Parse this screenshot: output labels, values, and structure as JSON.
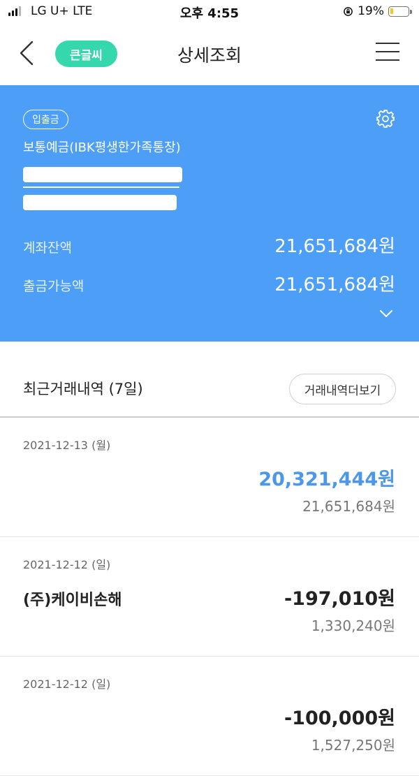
{
  "status_bar": {
    "carrier": "LG U+  LTE",
    "time": "오후 4:55",
    "battery": "19%",
    "battery_level": 0.19
  },
  "header": {
    "back_icon": "chevron-left-icon",
    "pill_label": "큰글씨",
    "title": "상세조회",
    "menu_icon": "hamburger-menu-icon",
    "accent_color": "#35d7ad"
  },
  "account": {
    "badge": "입출금",
    "settings_icon": "gear-icon",
    "name": "보통예금(IBK평생한가족통장)",
    "balance_label": "계좌잔액",
    "balance_value": "21,651,684원",
    "available_label": "출금가능액",
    "available_value": "21,651,684원",
    "expand_icon": "chevron-down-icon",
    "card_color": "#4c9ef7"
  },
  "recent": {
    "title": "최근거래내역 (7일)",
    "more_button": "거래내역더보기",
    "transactions": [
      {
        "date": "2021-12-13 (월)",
        "description": "",
        "amount": "20,321,444원",
        "balance": "21,651,684원",
        "type": "deposit"
      },
      {
        "date": "2021-12-12 (일)",
        "description": "(주)케이비손해",
        "amount": "-197,010원",
        "balance": "1,330,240원",
        "type": "withdrawal"
      },
      {
        "date": "2021-12-12 (일)",
        "description": "",
        "amount": "-100,000원",
        "balance": "1,527,250원",
        "type": "withdrawal"
      }
    ]
  }
}
